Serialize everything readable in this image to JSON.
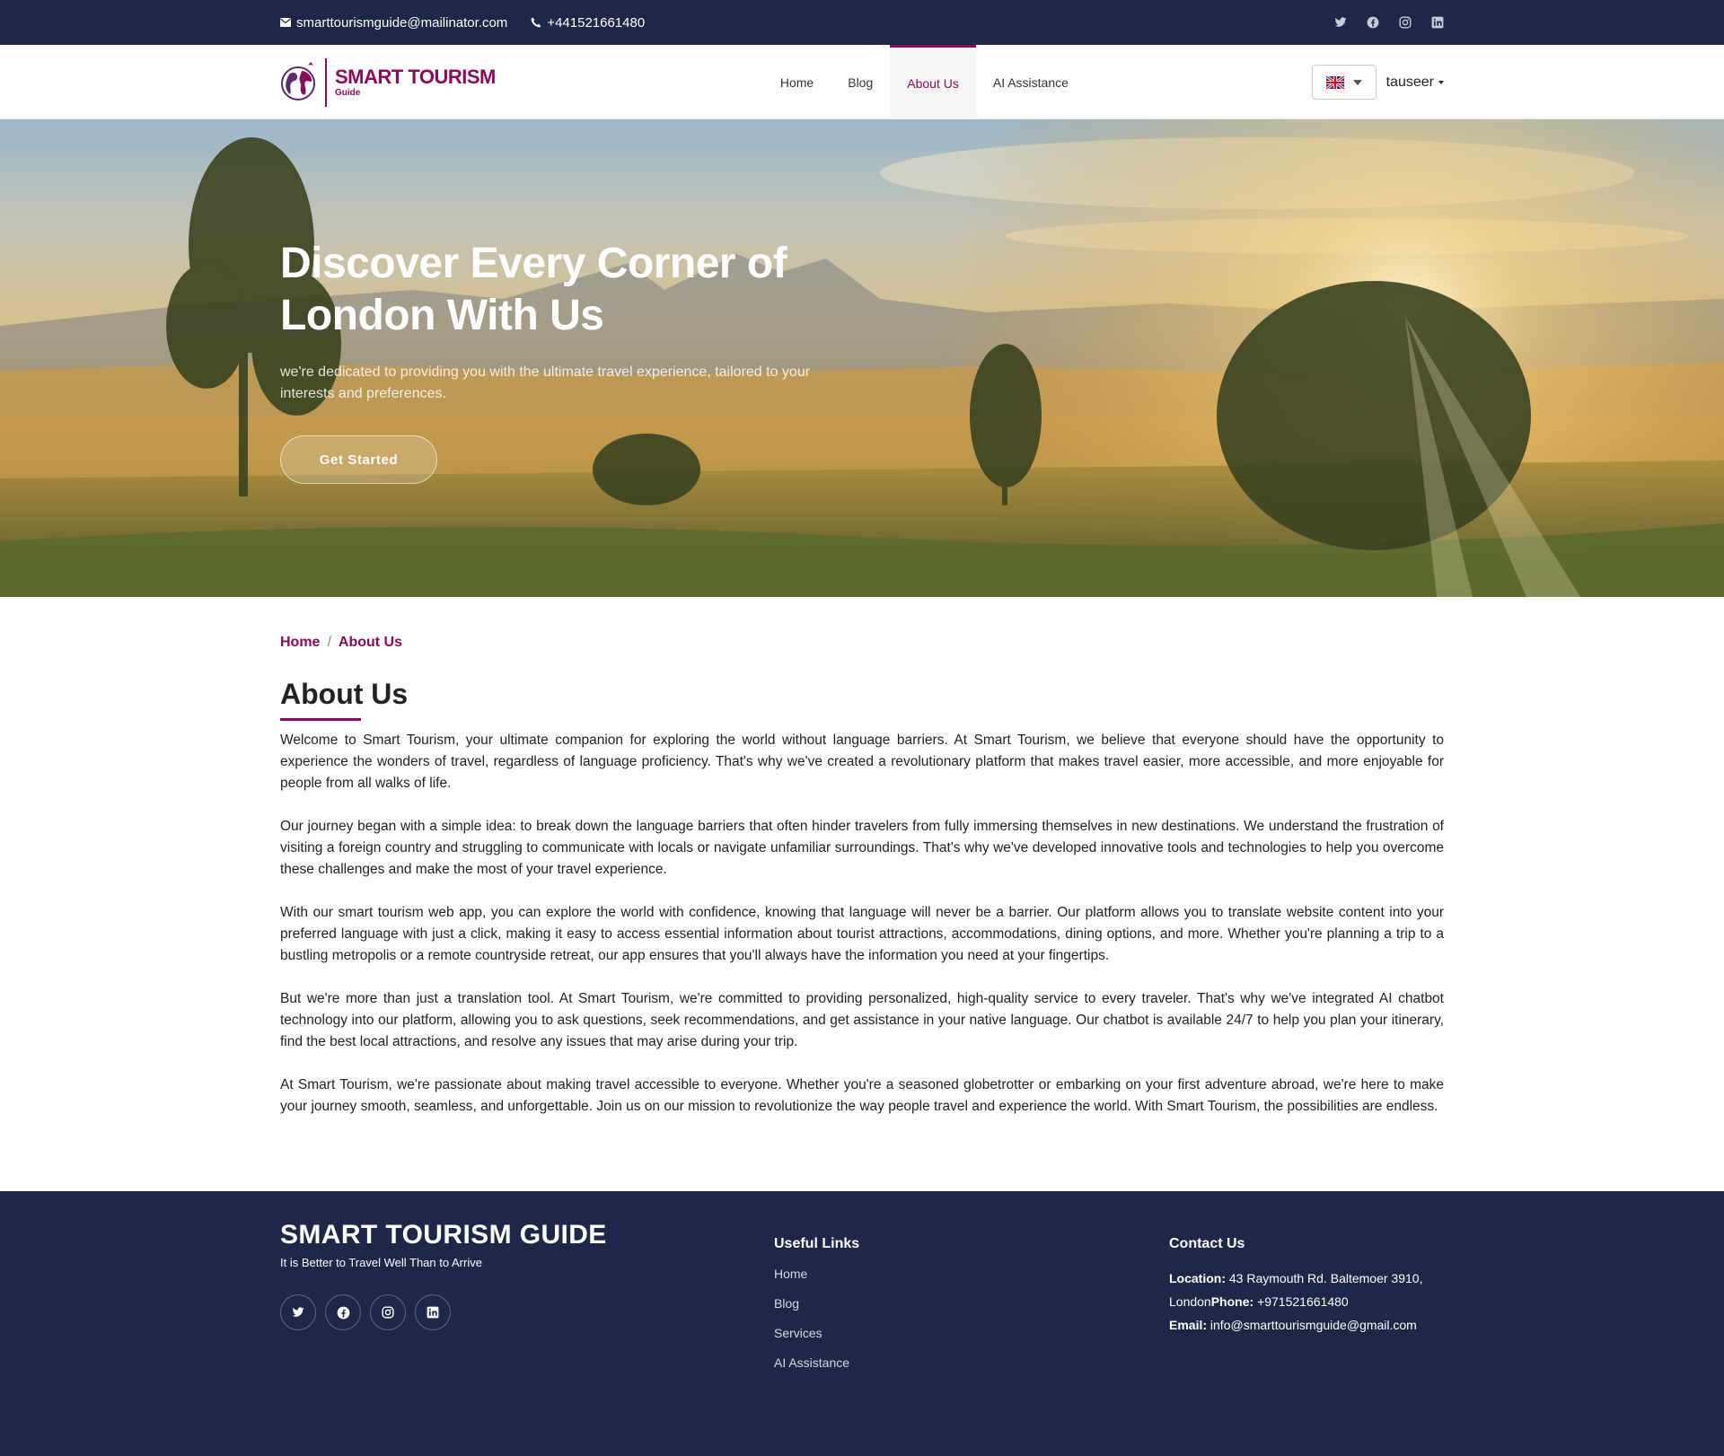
{
  "topbar": {
    "email": "smarttourismguide@mailinator.com",
    "phone": "+441521661480",
    "socials": [
      "twitter-icon",
      "facebook-icon",
      "instagram-icon",
      "linkedin-icon"
    ]
  },
  "brand": {
    "logo_title": "SMART TOURISM",
    "logo_sub": "Guide",
    "accent": "#8a0b5a",
    "navy": "#1e2747"
  },
  "nav": {
    "items": [
      {
        "label": "Home"
      },
      {
        "label": "Blog"
      },
      {
        "label": "About Us"
      },
      {
        "label": "AI Assistance"
      }
    ],
    "active": "About Us",
    "user": "tauseer"
  },
  "hero": {
    "title": "Discover Every Corner of London With Us",
    "subtitle": "we're dedicated to providing you with the ultimate travel experience, tailored to your interests and preferences.",
    "cta": "Get Started"
  },
  "breadcrumb": {
    "home": "Home",
    "separator": "/",
    "current": "About Us"
  },
  "about": {
    "heading": "About Us",
    "paragraphs": [
      "Welcome to Smart Tourism, your ultimate companion for exploring the world without language barriers. At Smart Tourism, we believe that everyone should have the opportunity to experience the wonders of travel, regardless of language proficiency. That's why we've created a revolutionary platform that makes travel easier, more accessible, and more enjoyable for people from all walks of life.",
      "Our journey began with a simple idea: to break down the language barriers that often hinder travelers from fully immersing themselves in new destinations. We understand the frustration of visiting a foreign country and struggling to communicate with locals or navigate unfamiliar surroundings. That's why we've developed innovative tools and technologies to help you overcome these challenges and make the most of your travel experience.",
      "With our smart tourism web app, you can explore the world with confidence, knowing that language will never be a barrier. Our platform allows you to translate website content into your preferred language with just a click, making it easy to access essential information about tourist attractions, accommodations, dining options, and more. Whether you're planning a trip to a bustling metropolis or a remote countryside retreat, our app ensures that you'll always have the information you need at your fingertips.",
      "But we're more than just a translation tool. At Smart Tourism, we're committed to providing personalized, high-quality service to every traveler. That's why we've integrated AI chatbot technology into our platform, allowing you to ask questions, seek recommendations, and get assistance in your native language. Our chatbot is available 24/7 to help you plan your itinerary, find the best local attractions, and resolve any issues that may arise during your trip.",
      "At Smart Tourism, we're passionate about making travel accessible to everyone. Whether you're a seasoned globetrotter or embarking on your first adventure abroad, we're here to make your journey smooth, seamless, and unforgettable. Join us on our mission to revolutionize the way people travel and experience the world. With Smart Tourism, the possibilities are endless."
    ]
  },
  "footer": {
    "brand": "SMART TOURISM GUIDE",
    "tagline": "It is Better to Travel Well Than to Arrive",
    "links_title": "Useful Links",
    "links": [
      "Home",
      "Blog",
      "Services",
      "AI Assistance"
    ],
    "contact_title": "Contact Us",
    "location_label": "Location:",
    "location": "43 Raymouth Rd. Baltemoer 3910, London",
    "phone_label": "Phone:",
    "phone": "+971521661480",
    "email_label": "Email:",
    "email": "info@smarttourismguide@gmail.com"
  }
}
